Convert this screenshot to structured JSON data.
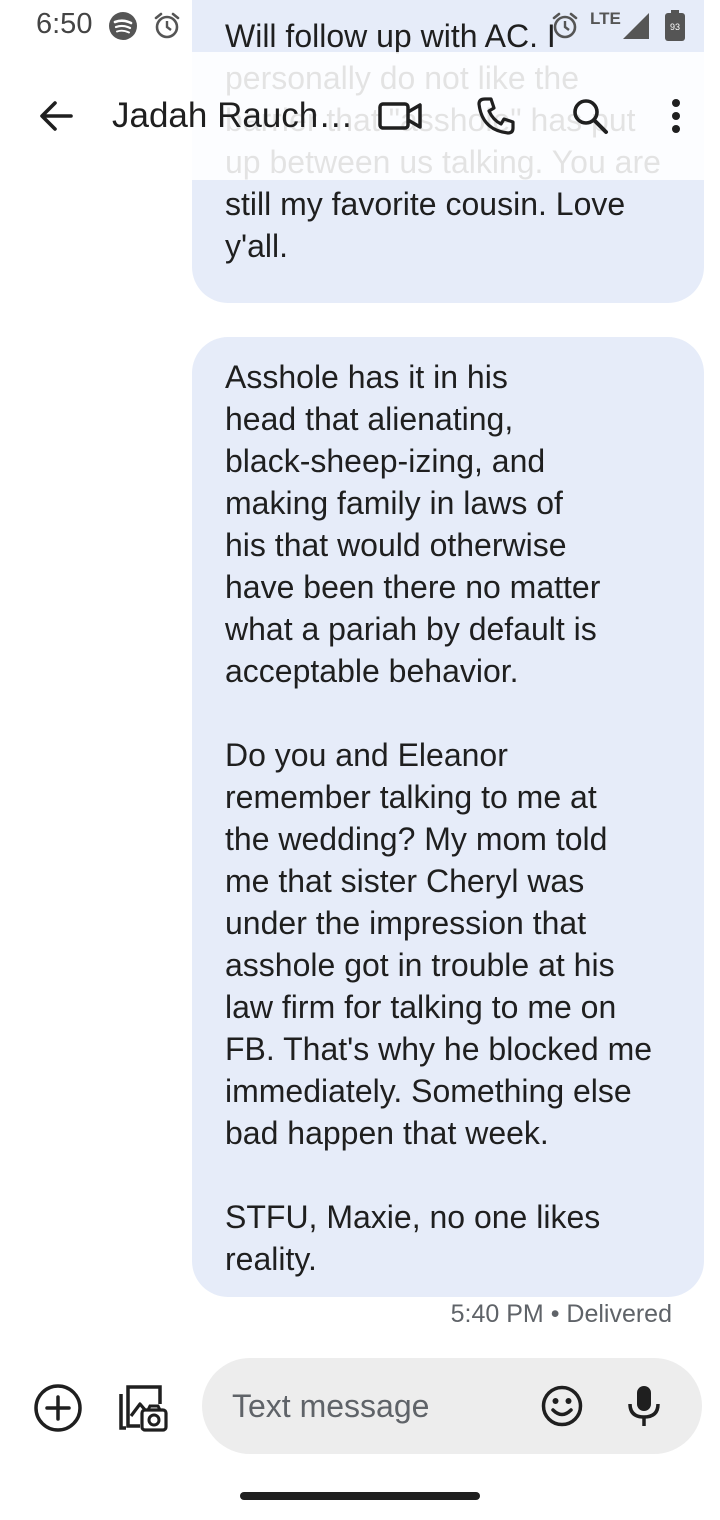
{
  "status_bar": {
    "time": "6:50",
    "network": "LTE",
    "battery": "93",
    "icons": [
      "spotify-icon",
      "alarm-icon",
      "alarm-icon",
      "signal-icon",
      "battery-icon"
    ]
  },
  "app_bar": {
    "title": "Jadah Rauch…",
    "actions": [
      "back-arrow-icon",
      "video-call-icon",
      "phone-icon",
      "search-icon",
      "more-vert-icon"
    ]
  },
  "messages": [
    {
      "id": "m1",
      "text": "Will follow up with AC. I personally do not like the barrier that \"asshole\" has put up between us talking. You are still my favorite cousin. Love y'all."
    },
    {
      "id": "m2",
      "text": "Asshole has it in his\nhead that alienating,\nblack-sheep-izing, and\nmaking family in laws of\nhis that would otherwise\nhave been there no matter\nwhat a pariah by default is\nacceptable behavior.\n\nDo you and Eleanor\nremember talking to me at\nthe wedding? My mom told\nme that sister Cheryl was\nunder the impression that\nasshole got in trouble at his\nlaw firm for talking to me on\nFB. That's why he blocked me\nimmediately. Something else\nbad happen that week.\n\nSTFU, Maxie, no one likes\nreality.",
      "meta": "5:40 PM • Delivered"
    }
  ],
  "composer": {
    "placeholder": "Text message",
    "icons": [
      "add-circle-icon",
      "gallery-camera-icon",
      "emoji-icon",
      "mic-icon"
    ]
  },
  "colors": {
    "bubble_outgoing": "#e6ecf9",
    "input_background": "#ededed",
    "text_primary": "#1f1f1f",
    "text_secondary": "#5f6368"
  }
}
